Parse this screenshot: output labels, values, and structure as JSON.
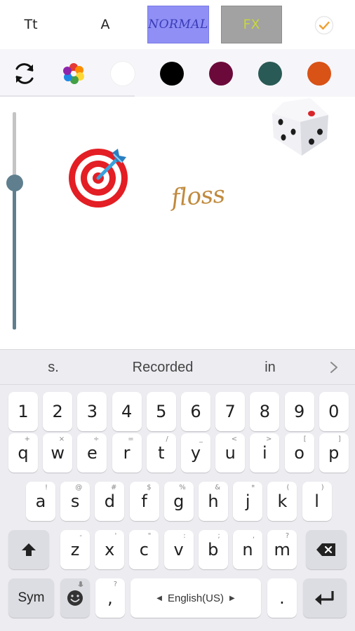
{
  "toolbar": {
    "text_style_label": "Tt",
    "font_label": "A",
    "normal_label": "NORMAL",
    "fx_label": "FX",
    "confirm_icon": "check-circle-icon",
    "colors": {
      "normal_bg": "#8f8ff5",
      "fx_bg": "#a2a2a2",
      "check": "#f0a030"
    }
  },
  "color_row": {
    "refresh_icon": "refresh-icon",
    "palette_icon": "color-palette-icon",
    "swatches": [
      "#ffffff",
      "#000000",
      "#6b0a3a",
      "#2a5a55",
      "#d95216"
    ]
  },
  "canvas": {
    "sticker_text": "floss",
    "stickers": [
      "target-dart-icon",
      "dice-icon"
    ],
    "slider": {
      "value_fraction": 0.35,
      "track_color": "#5f7f8f"
    }
  },
  "keyboard": {
    "suggestions": [
      "s.",
      "Recorded",
      "in"
    ],
    "number_row": [
      "1",
      "2",
      "3",
      "4",
      "5",
      "6",
      "7",
      "8",
      "9",
      "0"
    ],
    "row1": [
      {
        "k": "q",
        "s": "+"
      },
      {
        "k": "w",
        "s": "×"
      },
      {
        "k": "e",
        "s": "÷"
      },
      {
        "k": "r",
        "s": "="
      },
      {
        "k": "t",
        "s": "/"
      },
      {
        "k": "y",
        "s": "_"
      },
      {
        "k": "u",
        "s": "<"
      },
      {
        "k": "i",
        "s": ">"
      },
      {
        "k": "o",
        "s": "["
      },
      {
        "k": "p",
        "s": "]"
      }
    ],
    "row2": [
      {
        "k": "a",
        "s": "!"
      },
      {
        "k": "s",
        "s": "@"
      },
      {
        "k": "d",
        "s": "#"
      },
      {
        "k": "f",
        "s": "$"
      },
      {
        "k": "g",
        "s": "%"
      },
      {
        "k": "h",
        "s": "&"
      },
      {
        "k": "j",
        "s": "*"
      },
      {
        "k": "k",
        "s": "("
      },
      {
        "k": "l",
        "s": ")"
      }
    ],
    "row3": [
      {
        "k": "z",
        "s": "-"
      },
      {
        "k": "x",
        "s": "'"
      },
      {
        "k": "c",
        "s": "\""
      },
      {
        "k": "v",
        "s": ":"
      },
      {
        "k": "b",
        "s": ";"
      },
      {
        "k": "n",
        "s": ","
      },
      {
        "k": "m",
        "s": "?"
      }
    ],
    "sym_label": "Sym",
    "comma_label": ",",
    "comma_sub": "?",
    "space_label": "English(US)",
    "period_label": "."
  }
}
